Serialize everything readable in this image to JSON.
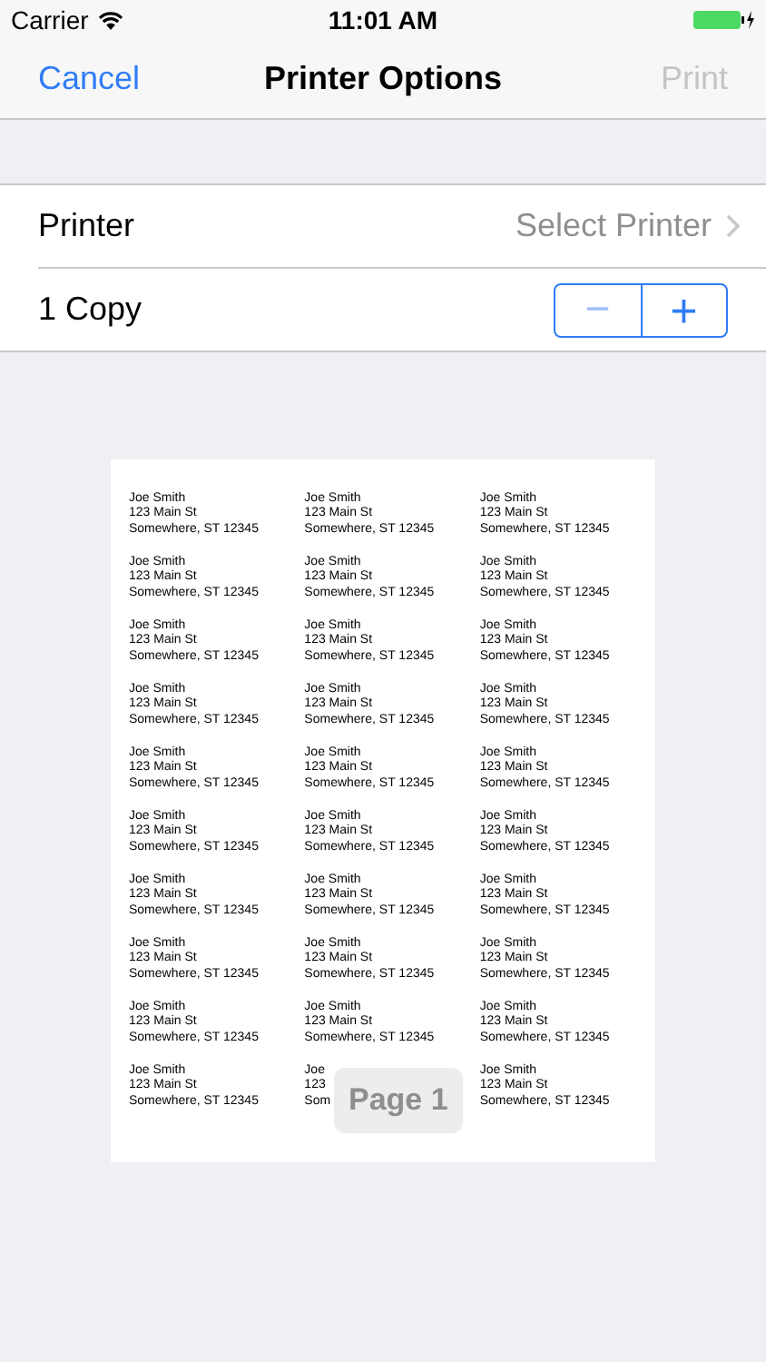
{
  "status_bar": {
    "carrier": "Carrier",
    "time": "11:01 AM"
  },
  "nav": {
    "cancel": "Cancel",
    "title": "Printer Options",
    "print": {
      "label": "Print",
      "disabled": true
    }
  },
  "options": [
    {
      "kind": "link",
      "label": "Printer",
      "value": "Select Printer"
    },
    {
      "kind": "stepper",
      "label": "1 Copy",
      "minus": "−",
      "plus": "+"
    }
  ],
  "preview": {
    "page_badge": "Page 1",
    "labels": [
      [
        [
          "Joe Smith",
          "123 Main St",
          "Somewhere, ST 12345"
        ],
        [
          "Joe Smith",
          "123 Main St",
          "Somewhere, ST 12345"
        ],
        [
          "Joe Smith",
          "123 Main St",
          "Somewhere, ST 12345"
        ]
      ],
      [
        [
          "Joe Smith",
          "123 Main St",
          "Somewhere, ST 12345"
        ],
        [
          "Joe Smith",
          "123 Main St",
          "Somewhere, ST 12345"
        ],
        [
          "Joe Smith",
          "123 Main St",
          "Somewhere, ST 12345"
        ]
      ],
      [
        [
          "Joe Smith",
          "123 Main St",
          "Somewhere, ST 12345"
        ],
        [
          "Joe Smith",
          "123 Main St",
          "Somewhere, ST 12345"
        ],
        [
          "Joe Smith",
          "123 Main St",
          "Somewhere, ST 12345"
        ]
      ],
      [
        [
          "Joe Smith",
          "123 Main St",
          "Somewhere, ST 12345"
        ],
        [
          "Joe Smith",
          "123 Main St",
          "Somewhere, ST 12345"
        ],
        [
          "Joe Smith",
          "123 Main St",
          "Somewhere, ST 12345"
        ]
      ],
      [
        [
          "Joe Smith",
          "123 Main St",
          "Somewhere, ST 12345"
        ],
        [
          "Joe Smith",
          "123 Main St",
          "Somewhere, ST 12345"
        ],
        [
          "Joe Smith",
          "123 Main St",
          "Somewhere, ST 12345"
        ]
      ],
      [
        [
          "Joe Smith",
          "123 Main St",
          "Somewhere, ST 12345"
        ],
        [
          "Joe Smith",
          "123 Main St",
          "Somewhere, ST 12345"
        ],
        [
          "Joe Smith",
          "123 Main St",
          "Somewhere, ST 12345"
        ]
      ],
      [
        [
          "Joe Smith",
          "123 Main St",
          "Somewhere, ST 12345"
        ],
        [
          "Joe Smith",
          "123 Main St",
          "Somewhere, ST 12345"
        ],
        [
          "Joe Smith",
          "123 Main St",
          "Somewhere, ST 12345"
        ]
      ],
      [
        [
          "Joe Smith",
          "123 Main St",
          "Somewhere, ST 12345"
        ],
        [
          "Joe Smith",
          "123 Main St",
          "Somewhere, ST 12345"
        ],
        [
          "Joe Smith",
          "123 Main St",
          "Somewhere, ST 12345"
        ]
      ],
      [
        [
          "Joe Smith",
          "123 Main St",
          "Somewhere, ST 12345"
        ],
        [
          "Joe Smith",
          "123 Main St",
          "Somewhere, ST 12345"
        ],
        [
          "Joe Smith",
          "123 Main St",
          "Somewhere, ST 12345"
        ]
      ],
      [
        [
          "Joe Smith",
          "123 Main St",
          "Somewhere, ST 12345"
        ],
        [
          "Joe",
          "123",
          "Som"
        ],
        [
          "Joe Smith",
          "123 Main St",
          "Somewhere, ST 12345"
        ]
      ]
    ]
  }
}
